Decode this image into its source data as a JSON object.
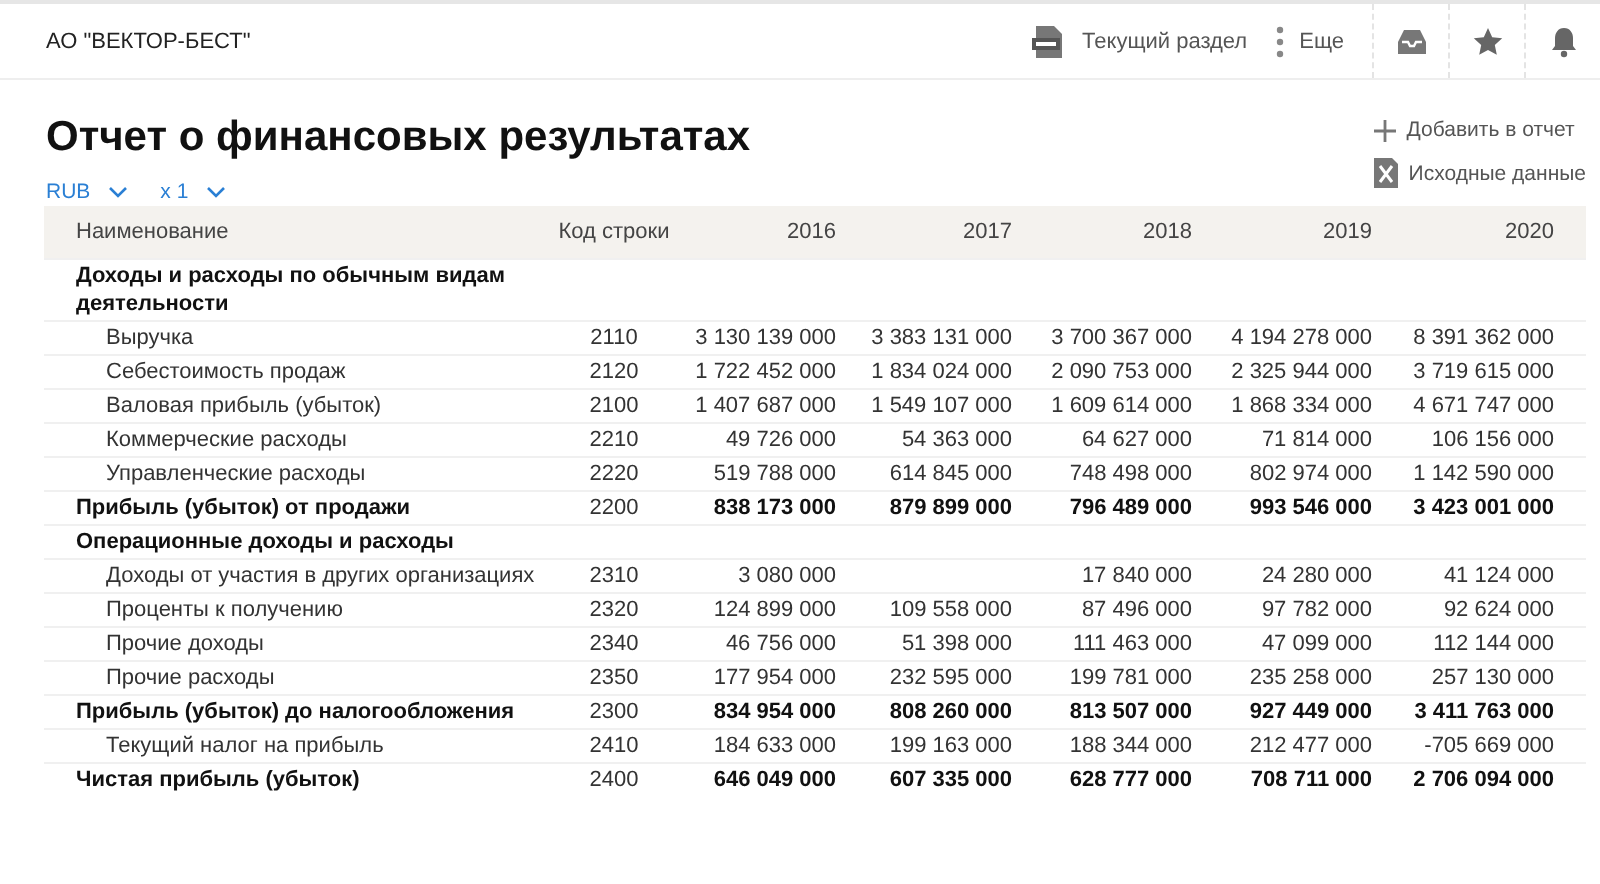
{
  "company": "АО \"ВЕКТОР-БЕСТ\"",
  "top_actions": [
    {
      "kind": "doc",
      "label": "Текущий раздел"
    },
    {
      "kind": "more",
      "label": "Еще"
    }
  ],
  "top_icons": [
    {
      "kind": "inbox"
    },
    {
      "kind": "star"
    },
    {
      "kind": "bell"
    }
  ],
  "title": "Отчет о финансовых результатах",
  "filters": [
    {
      "label": "RUB"
    },
    {
      "label": "x 1"
    }
  ],
  "side_actions": [
    {
      "kind": "add",
      "label": "Добавить в отчет"
    },
    {
      "kind": "excel",
      "label": "Исходные данные"
    }
  ],
  "table": {
    "columns": [
      "Наименование",
      "Код строки",
      "2016",
      "2017",
      "2018",
      "2019",
      "2020"
    ],
    "rows": [
      {
        "kind": "section",
        "name": "Доходы и расходы по обычным видам деятельности"
      },
      {
        "kind": "item",
        "name": "Выручка",
        "code": "2110",
        "values": [
          "3 130 139 000",
          "3 383 131 000",
          "3 700 367 000",
          "4 194 278 000",
          "8 391 362 000"
        ]
      },
      {
        "kind": "item",
        "name": "Себестоимость продаж",
        "code": "2120",
        "values": [
          "1 722 452 000",
          "1 834 024 000",
          "2 090 753 000",
          "2 325 944 000",
          "3 719 615 000"
        ]
      },
      {
        "kind": "item",
        "name": "Валовая прибыль (убыток)",
        "code": "2100",
        "values": [
          "1 407 687 000",
          "1 549 107 000",
          "1 609 614 000",
          "1 868 334 000",
          "4 671 747 000"
        ]
      },
      {
        "kind": "item",
        "name": "Коммерческие расходы",
        "code": "2210",
        "values": [
          "49 726 000",
          "54 363 000",
          "64 627 000",
          "71 814 000",
          "106 156 000"
        ]
      },
      {
        "kind": "item",
        "name": "Управленческие расходы",
        "code": "2220",
        "values": [
          "519 788 000",
          "614 845 000",
          "748 498 000",
          "802 974 000",
          "1 142 590 000"
        ]
      },
      {
        "kind": "total",
        "name": "Прибыль (убыток) от продажи",
        "code": "2200",
        "values": [
          "838 173 000",
          "879 899 000",
          "796 489 000",
          "993 546 000",
          "3 423 001 000"
        ]
      },
      {
        "kind": "section",
        "name": "Операционные доходы и расходы"
      },
      {
        "kind": "item",
        "name": "Доходы от участия в других организациях",
        "code": "2310",
        "values": [
          "3 080 000",
          {
            "kind": "empty"
          },
          "17 840 000",
          "24 280 000",
          "41 124 000"
        ]
      },
      {
        "kind": "item",
        "name": "Проценты к получению",
        "code": "2320",
        "values": [
          "124 899 000",
          "109 558 000",
          "87 496 000",
          "97 782 000",
          "92 624 000"
        ]
      },
      {
        "kind": "item",
        "name": "Прочие доходы",
        "code": "2340",
        "values": [
          "46 756 000",
          "51 398 000",
          "111 463 000",
          "47 099 000",
          "112 144 000"
        ]
      },
      {
        "kind": "item",
        "name": "Прочие расходы",
        "code": "2350",
        "values": [
          "177 954 000",
          "232 595 000",
          "199 781 000",
          "235 258 000",
          "257 130 000"
        ]
      },
      {
        "kind": "total",
        "name": "Прибыль (убыток) до налогообложения",
        "code": "2300",
        "values": [
          "834 954 000",
          "808 260 000",
          "813 507 000",
          "927 449 000",
          "3 411 763 000"
        ]
      },
      {
        "kind": "item",
        "name": "Текущий налог на прибыль",
        "code": "2410",
        "values": [
          "184 633 000",
          "199 163 000",
          "188 344 000",
          "212 477 000",
          "-705 669 000"
        ]
      },
      {
        "kind": "total",
        "name": "Чистая прибыль (убыток)",
        "code": "2400",
        "values": [
          "646 049 000",
          "607 335 000",
          "628 777 000",
          "708 711 000",
          "2 706 094 000"
        ]
      }
    ]
  }
}
